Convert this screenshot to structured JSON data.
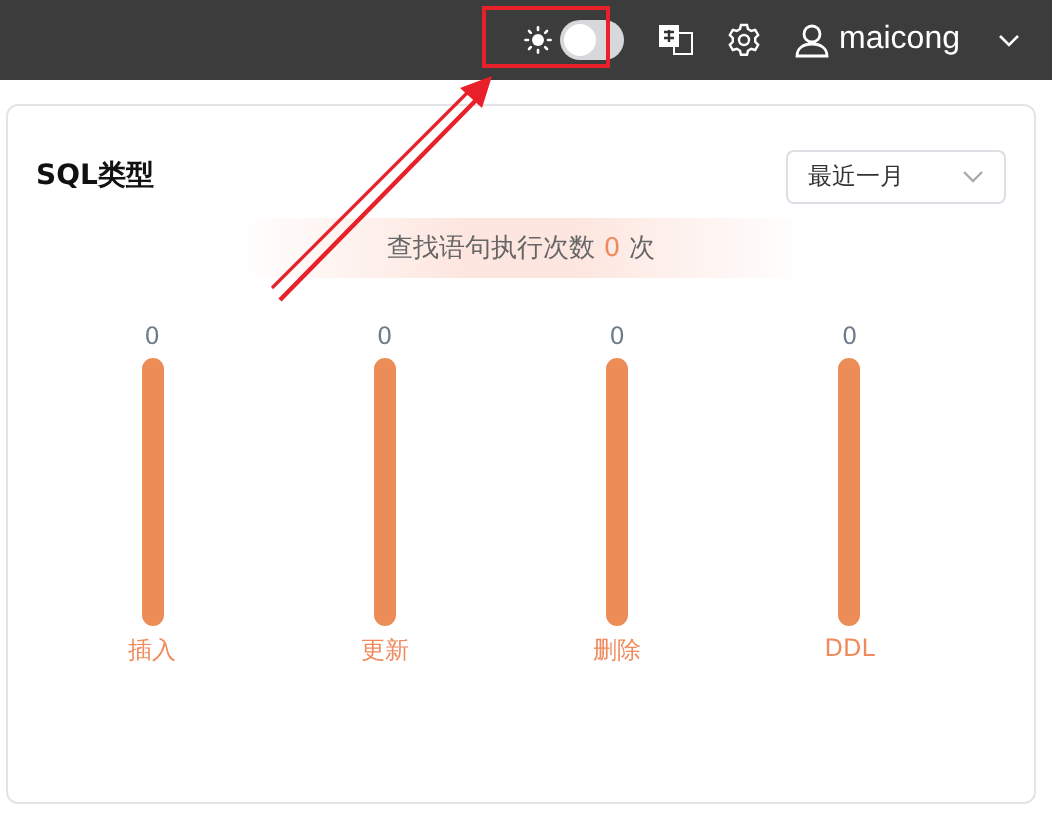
{
  "header": {
    "theme_toggle": {
      "on": false
    },
    "user": "maicong"
  },
  "card": {
    "title": "SQL类型",
    "period_select": {
      "value": "最近一月"
    },
    "summary": {
      "prefix": "查找语句执行次数",
      "count": "0",
      "suffix": "次"
    },
    "metrics": [
      {
        "value": "0",
        "label": "插入"
      },
      {
        "value": "0",
        "label": "更新"
      },
      {
        "value": "0",
        "label": "删除"
      },
      {
        "value": "0",
        "label": "DDL"
      }
    ]
  }
}
